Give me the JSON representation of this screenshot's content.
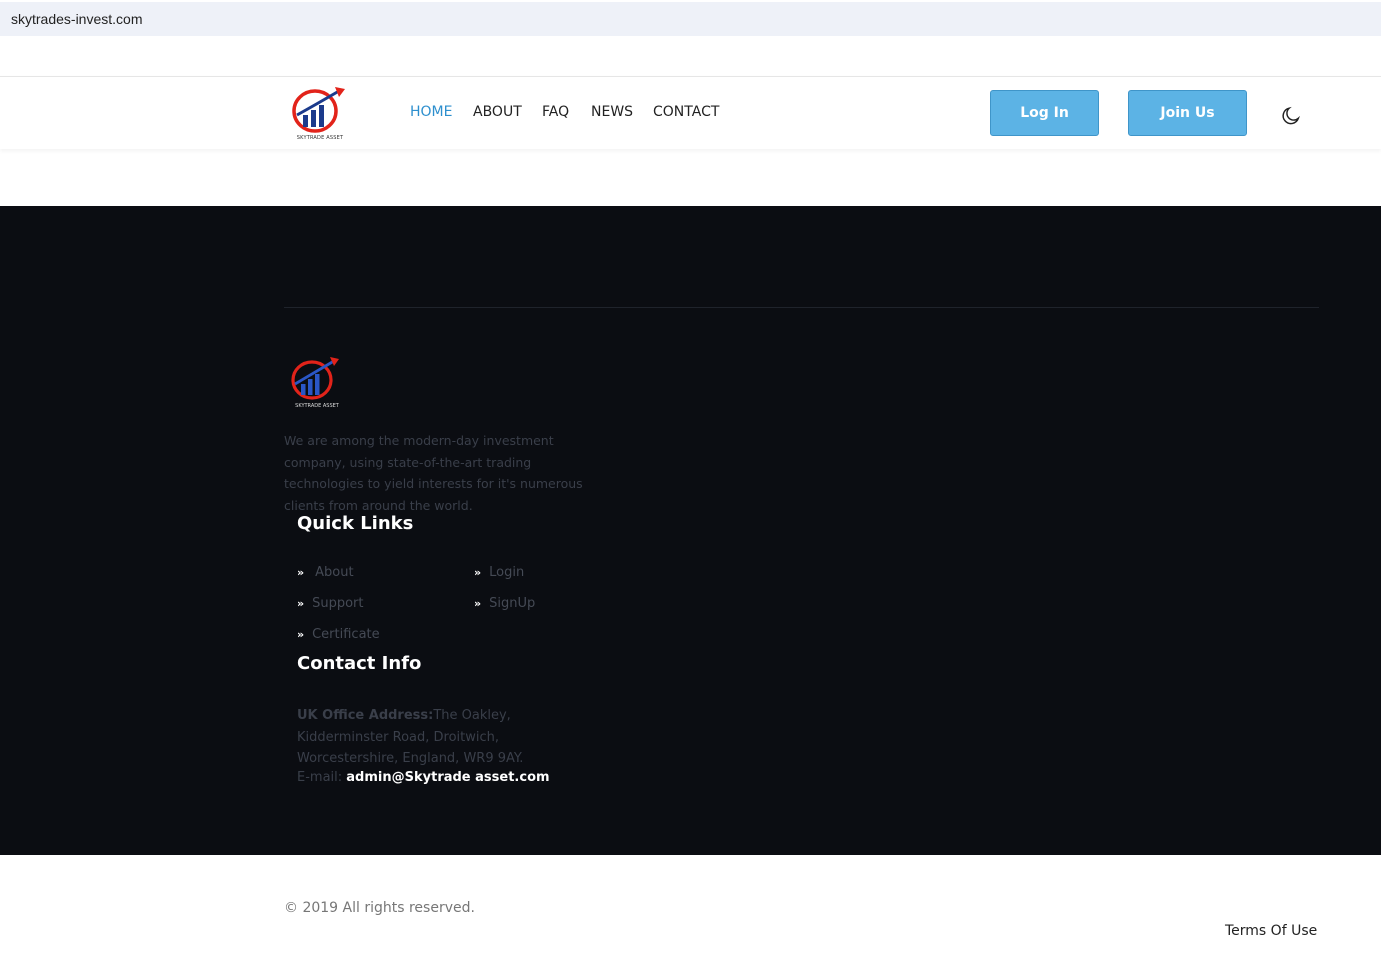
{
  "browser": {
    "url": "skytrades-invest.com"
  },
  "header": {
    "logo_caption": "SKYTRADE ASSET",
    "nav": [
      {
        "label": "HOME",
        "active": true
      },
      {
        "label": "ABOUT"
      },
      {
        "label": "FAQ"
      },
      {
        "label": "NEWS"
      },
      {
        "label": "CONTACT"
      }
    ],
    "login_label": "Log In",
    "join_label": "Join Us",
    "theme_icon": "moon-icon"
  },
  "footer": {
    "logo_caption": "SKYTRADE ASSET",
    "about_text": "We are among the modern-day investment company, using state-of-the-art trading technologies to yield interests for it's numerous clients from around the world.",
    "quick_links_title": "Quick Links",
    "quick_links": [
      "About",
      "Login",
      "Support",
      "SignUp",
      "Certificate"
    ],
    "contact_title": "Contact Info",
    "address_label": "UK Office Address:",
    "address_value": "The Oakley, Kidderminster Road, Droitwich, Worcestershire, England, WR9 9AY.",
    "email_label": "E-mail:",
    "email_value": "admin@Skytrade asset.com"
  },
  "bottom": {
    "copyright": "© 2019 All rights reserved.",
    "terms": "Terms Of Use"
  },
  "colors": {
    "accent": "#2d8fce",
    "button": "#5cb3e5",
    "footer_bg": "#0b0d12",
    "logo_red": "#e2231a",
    "logo_blue": "#1b3a8c"
  }
}
